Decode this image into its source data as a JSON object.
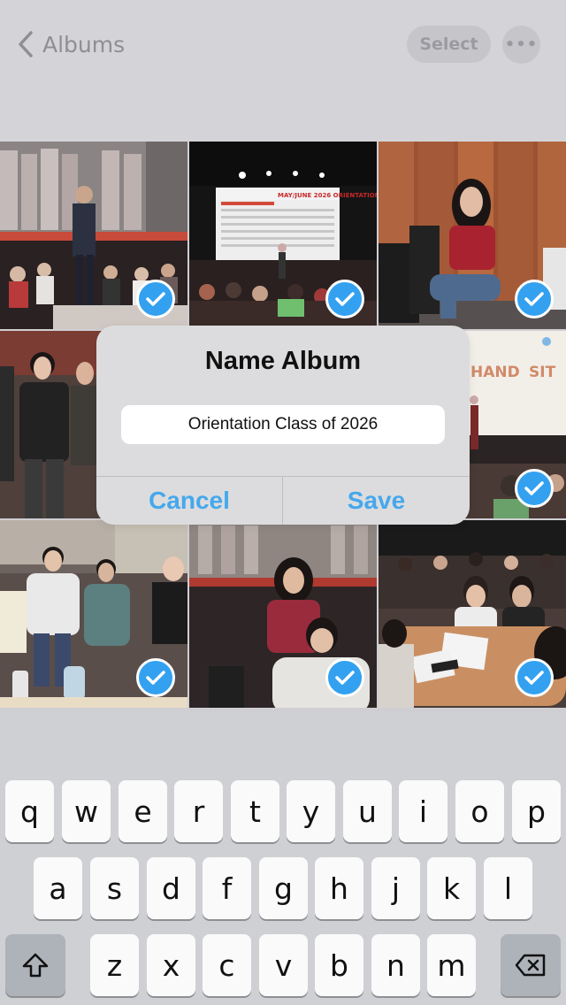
{
  "navbar": {
    "back_label": "Albums",
    "select_label": "Select",
    "more_label": "•••"
  },
  "grid": {
    "photos": [
      {
        "scene": "speaker on stage in hall",
        "selected": true
      },
      {
        "scene": "presentation screen orientation",
        "selected": true
      },
      {
        "scene": "girl in red shirt seated",
        "selected": true
      },
      {
        "scene": "students standing",
        "selected": false
      },
      {
        "scene": "stage banner hand sit",
        "selected": true
      },
      {
        "scene": "group of students smiling",
        "selected": true
      },
      {
        "scene": "students seated at table",
        "selected": true
      },
      {
        "scene": "students at round table",
        "selected": true
      }
    ],
    "banner_text_1": "HAND",
    "banner_text_2": "SIT",
    "screen_title": "MAY/JUNE 2026 ORIENTATION"
  },
  "dialog": {
    "title": "Name Album",
    "input_value": "Orientation Class of 2026",
    "cancel_label": "Cancel",
    "save_label": "Save"
  },
  "keyboard": {
    "row1": [
      "q",
      "w",
      "e",
      "r",
      "t",
      "y",
      "u",
      "i",
      "o",
      "p"
    ],
    "row2": [
      "a",
      "s",
      "d",
      "f",
      "g",
      "h",
      "j",
      "k",
      "l"
    ],
    "row3": [
      "z",
      "x",
      "c",
      "v",
      "b",
      "n",
      "m"
    ],
    "shift_icon": "shift-icon",
    "delete_icon": "backspace-icon"
  },
  "colors": {
    "accent": "#33a1f0",
    "dialog_button": "#45a8ec"
  }
}
